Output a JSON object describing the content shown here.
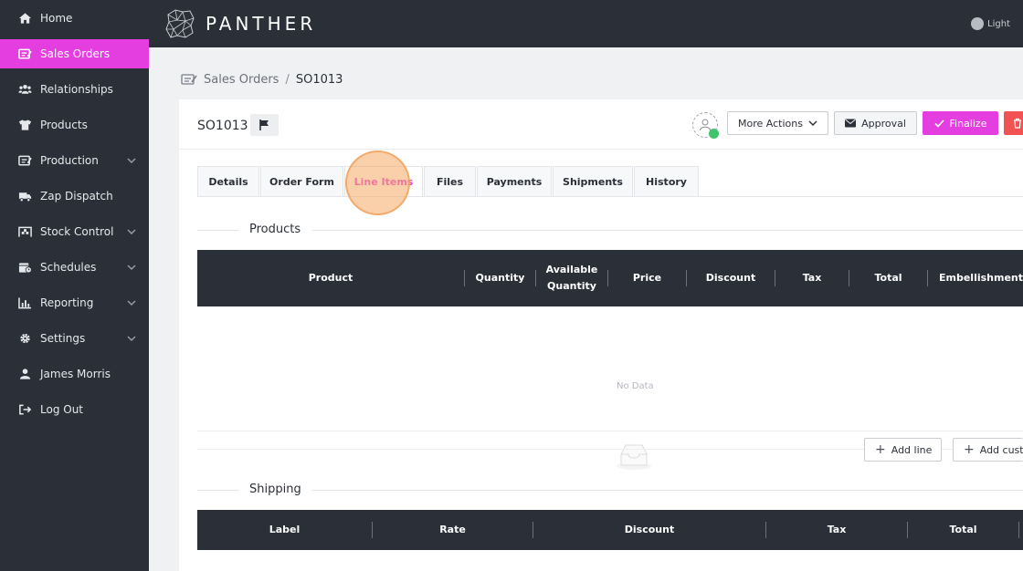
{
  "sidebar": {
    "items": [
      {
        "label": "Home",
        "icon": "home-icon"
      },
      {
        "label": "Sales Orders",
        "icon": "sales-orders-icon",
        "active": true
      },
      {
        "label": "Relationships",
        "icon": "users-icon"
      },
      {
        "label": "Products",
        "icon": "shirt-icon"
      },
      {
        "label": "Production",
        "icon": "production-icon",
        "expandable": true
      },
      {
        "label": "Zap Dispatch",
        "icon": "truck-icon"
      },
      {
        "label": "Stock Control",
        "icon": "warehouse-icon",
        "expandable": true
      },
      {
        "label": "Schedules",
        "icon": "calendar-icon",
        "expandable": true
      },
      {
        "label": "Reporting",
        "icon": "chart-icon",
        "expandable": true
      },
      {
        "label": "Settings",
        "icon": "gear-icon",
        "expandable": true
      },
      {
        "label": "James Morris",
        "icon": "user-icon"
      },
      {
        "label": "Log Out",
        "icon": "logout-icon"
      }
    ]
  },
  "topbar": {
    "brand": "PANTHER",
    "theme_label": "Light"
  },
  "breadcrumb": {
    "parent": "Sales Orders",
    "separator": "/",
    "current": "SO1013"
  },
  "order": {
    "title": "SO1013"
  },
  "actions": {
    "more": "More Actions",
    "approval": "Approval",
    "finalize": "Finalize"
  },
  "tabs": [
    {
      "label": "Details"
    },
    {
      "label": "Order Form"
    },
    {
      "label": "Line Items",
      "active": true
    },
    {
      "label": "Files"
    },
    {
      "label": "Payments"
    },
    {
      "label": "Shipments"
    },
    {
      "label": "History"
    }
  ],
  "products": {
    "title": "Products",
    "columns": [
      "Product",
      "Quantity",
      "Available\nQuantity",
      "Price",
      "Discount",
      "Tax",
      "Total",
      "Embellishments"
    ],
    "empty_text": "No Data",
    "add_line": "Add line",
    "add_custom": "Add custom"
  },
  "shipping": {
    "title": "Shipping",
    "columns": [
      "Label",
      "Rate",
      "Discount",
      "Tax",
      "Total"
    ]
  },
  "colors": {
    "accent": "#e43ee1",
    "sidebar_bg": "#2b3038",
    "danger": "#f25252",
    "success": "#3ec46d"
  }
}
